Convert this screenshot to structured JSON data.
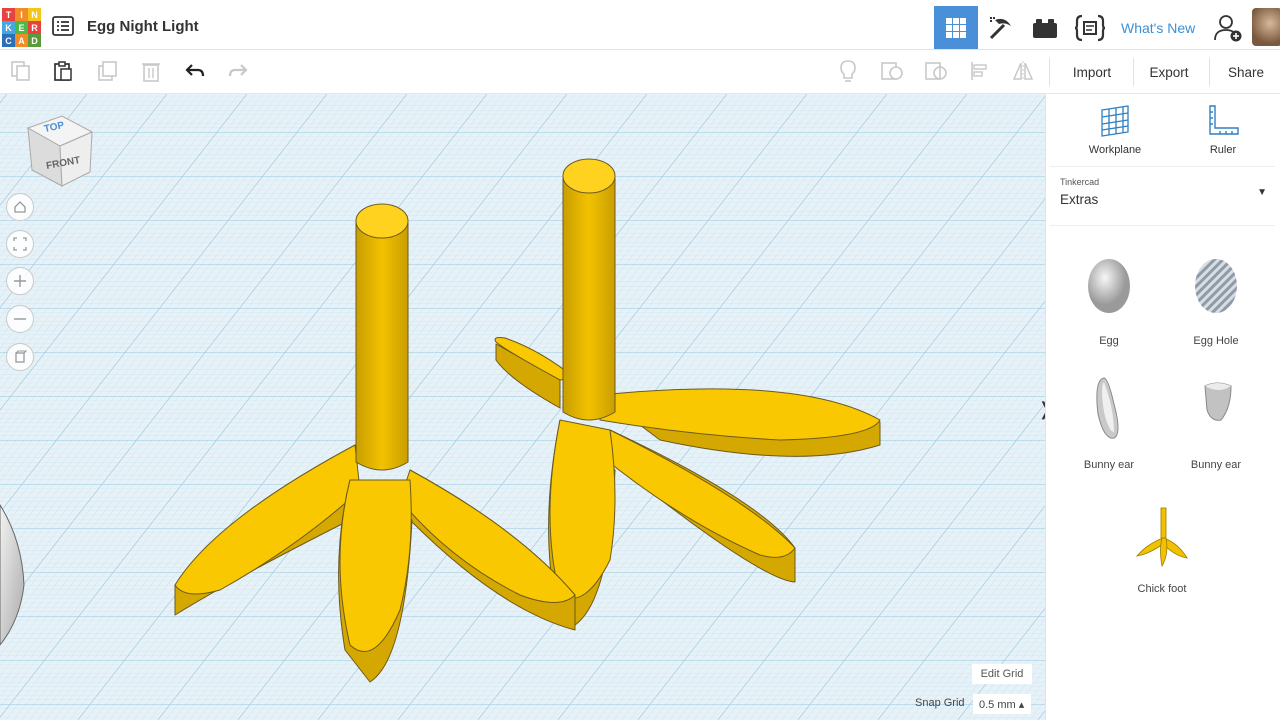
{
  "app": {
    "logo_letters": [
      "T",
      "I",
      "N",
      "K",
      "E",
      "R",
      "C",
      "A",
      "D"
    ],
    "logo_colors": [
      "#e8423f",
      "#f28c28",
      "#f5c519",
      "#44a8e0",
      "#4fb947",
      "#e8423f",
      "#2a6fb8",
      "#f28c28",
      "#5a9a3c"
    ],
    "project_title": "Egg Night Light",
    "whats_new": "What's New"
  },
  "header_icons": [
    "grid-view-icon",
    "pickaxe-icon",
    "bricks-icon",
    "code-blocks-icon",
    "user-add-icon"
  ],
  "toolbar": {
    "import_label": "Import",
    "export_label": "Export",
    "share_label": "Share"
  },
  "view_cube": {
    "top_label": "TOP",
    "front_label": "FRONT"
  },
  "workplane_controls": {
    "edit_grid_label": "Edit Grid",
    "snap_grid_label": "Snap Grid",
    "snap_grid_value": "0.5 mm ▴"
  },
  "panel": {
    "workplane_label": "Workplane",
    "ruler_label": "Ruler",
    "library_source": "Tinkercad",
    "library_name": "Extras",
    "shapes": [
      {
        "label": "Egg"
      },
      {
        "label": "Egg Hole"
      },
      {
        "label": "Bunny ear"
      },
      {
        "label": "Bunny ear"
      },
      {
        "label": "Chick foot"
      }
    ]
  },
  "colors": {
    "accent": "#4a90d9",
    "workplane": "#dfeef6",
    "shape_yellow": "#f9c800",
    "shape_yellow_side": "#d4a800"
  }
}
